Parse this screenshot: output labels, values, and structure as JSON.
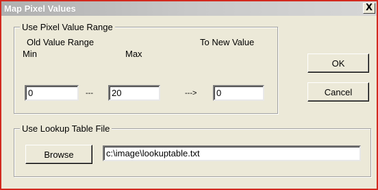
{
  "window": {
    "title": "Map Pixel Values",
    "close_glyph": "X"
  },
  "range_group": {
    "legend": "Use Pixel Value Range",
    "old_range_label": "Old Value Range",
    "min_label": "Min",
    "max_label": "Max",
    "new_value_label": "To New Value",
    "min_value": "0",
    "range_separator": "---",
    "max_value": "20",
    "arrow": "--->",
    "new_value": "0"
  },
  "lookup_group": {
    "legend": "Use Lookup Table File",
    "browse_label": "Browse",
    "file_path": "c:\\image\\lookuptable.txt"
  },
  "buttons": {
    "ok_label": "OK",
    "cancel_label": "Cancel"
  }
}
